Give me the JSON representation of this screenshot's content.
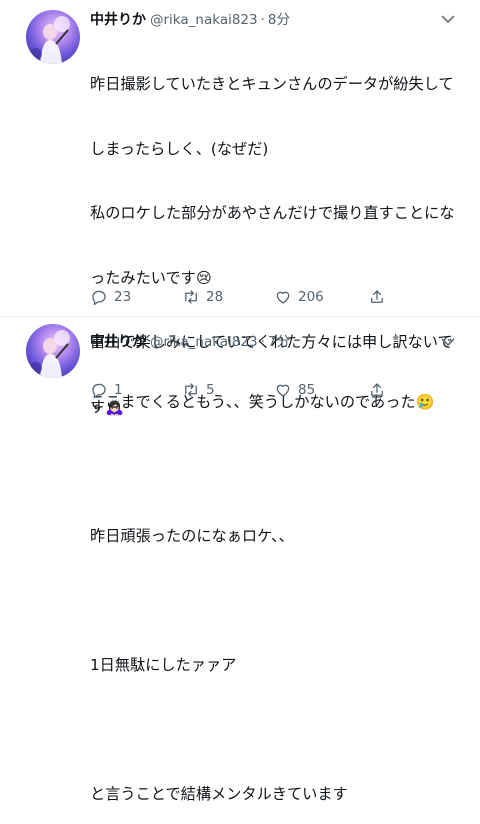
{
  "tweets": [
    {
      "author_name": "中井りか",
      "handle": "@rika_nakai823",
      "separator": "·",
      "time": "8分",
      "lines": [
        "昨日撮影していたきとキュンさんのデータが紛失して",
        "しまったらしく、(なぜだ)",
        "私のロケした部分があやさんだけで撮り直すことにな",
        "ったみたいです😢",
        "富山で楽しみにしていてくれた方々には申し訳ないで",
        "す🙇🏻‍♀️",
        "",
        "昨日頑張ったのになぁロケ、、",
        "",
        "1日無駄にしたァァア",
        "",
        "と言うことで結構メンタルきています"
      ],
      "reply_count": "23",
      "retweet_count": "28",
      "like_count": "206"
    },
    {
      "author_name": "中井りか",
      "handle": "@rika_nakai823",
      "separator": "·",
      "time": "7分",
      "lines": [
        "ここまでくるともう、、笑うしかないのであった🥲"
      ],
      "reply_count": "1",
      "retweet_count": "5",
      "like_count": "85"
    }
  ],
  "icons": {
    "caret": "chevron-down-icon",
    "reply": "reply-icon",
    "retweet": "retweet-icon",
    "like": "heart-icon",
    "share": "share-icon"
  },
  "colors": {
    "text": "#0f1419",
    "secondary": "#536471",
    "divider": "#eff3f4"
  }
}
